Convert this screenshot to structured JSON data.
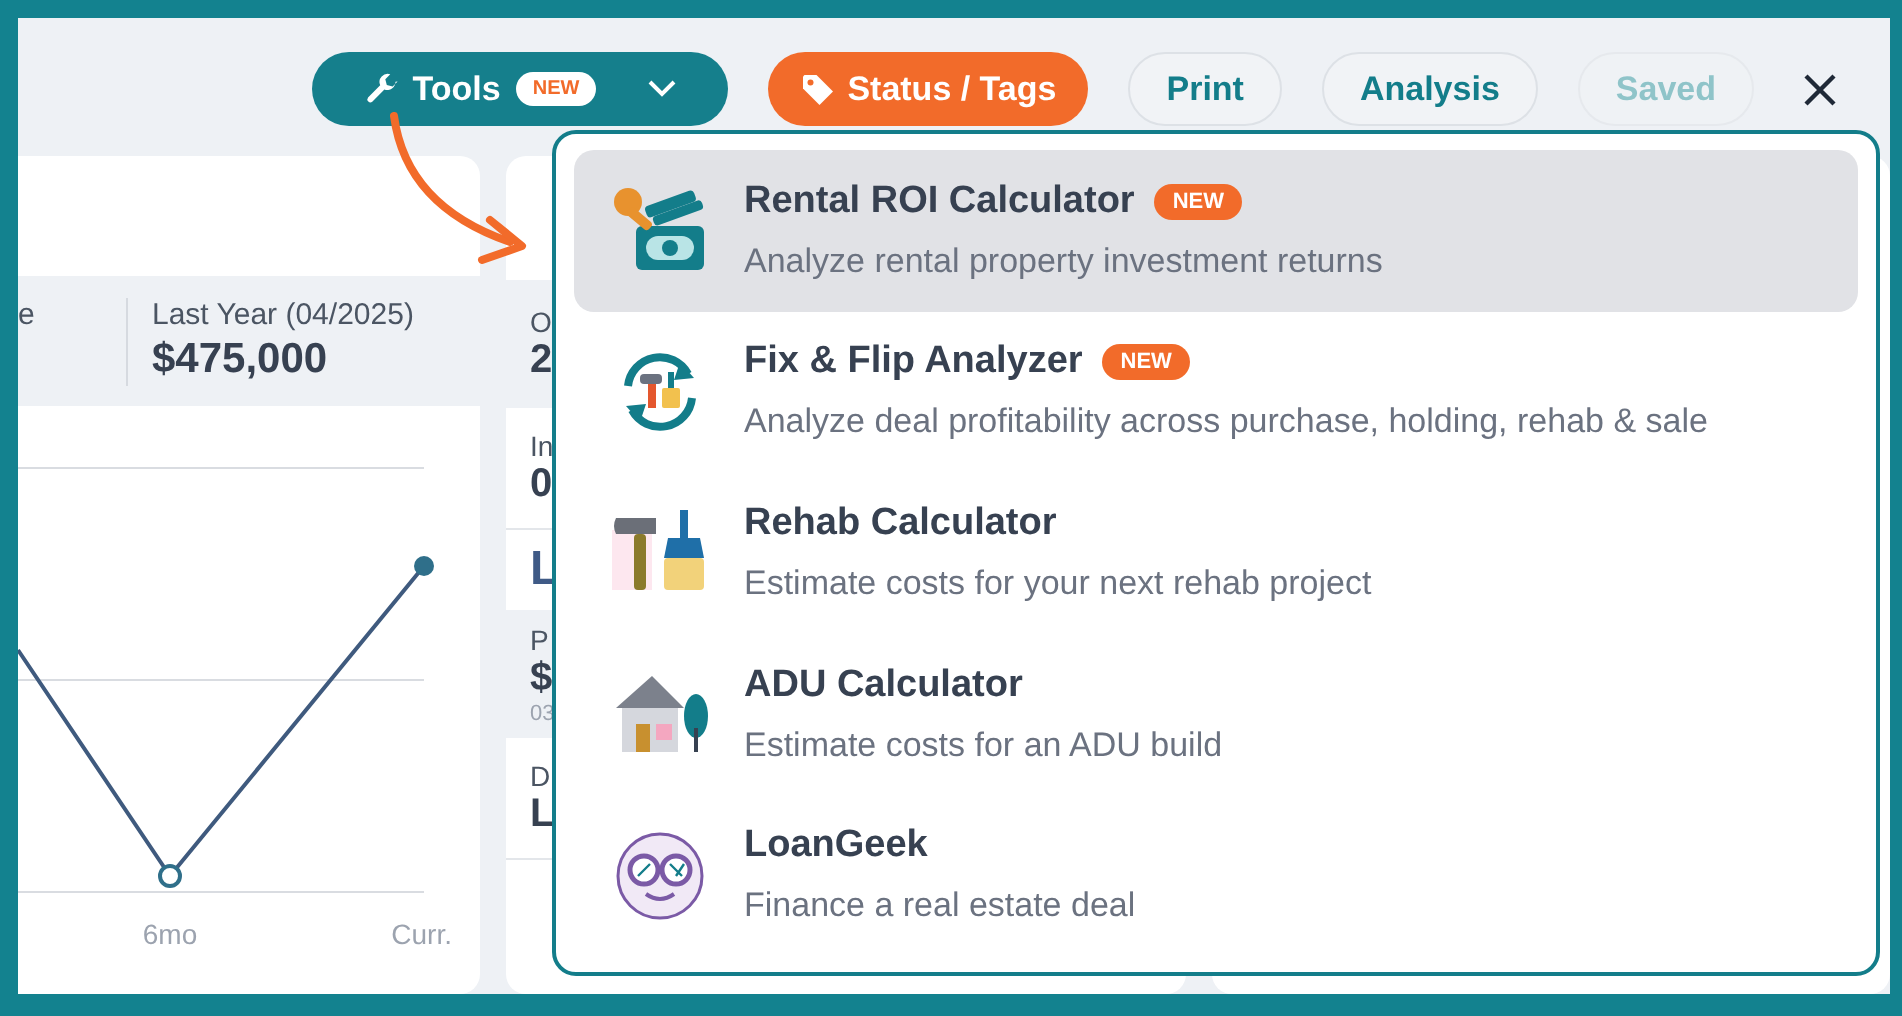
{
  "toolbar": {
    "tools_button": {
      "label": "Tools",
      "badge": "NEW",
      "expanded": true
    },
    "buttons": [
      {
        "label": "Status / Tags",
        "kind": "tag"
      },
      {
        "label": "Print",
        "kind": "plain",
        "disabled": false
      },
      {
        "label": "Analysis",
        "kind": "plain",
        "disabled": false
      },
      {
        "label": "Saved",
        "kind": "plain",
        "disabled": true
      }
    ]
  },
  "left_card": {
    "stats": [
      {
        "label": "e"
      },
      {
        "label": "Last Year (04/2025)",
        "value": "$475,000"
      }
    ],
    "chart": {
      "x_labels": [
        "6mo",
        "Curr."
      ]
    }
  },
  "middle_card": {
    "rows": [
      {
        "label": "O",
        "value": "2",
        "shaded": true
      },
      {
        "label": "In",
        "value": "0",
        "shaded": false
      }
    ],
    "section_title": "L",
    "section_rows": [
      {
        "label": "P",
        "value": "$",
        "note": "03",
        "shaded": true
      },
      {
        "label": "D",
        "value": "L",
        "shaded": false
      }
    ]
  },
  "tools_menu": [
    {
      "kind": "rental",
      "title": "Rental ROI Calculator",
      "badge": "NEW",
      "description": "Analyze rental property investment returns",
      "selected": true
    },
    {
      "kind": "flip",
      "title": "Fix & Flip Analyzer",
      "badge": "NEW",
      "description": "Analyze deal profitability across purchase, holding, rehab & sale",
      "selected": false
    },
    {
      "kind": "rehab",
      "title": "Rehab Calculator",
      "description": "Estimate costs for your next rehab project",
      "selected": false
    },
    {
      "kind": "adu",
      "title": "ADU Calculator",
      "description": "Estimate costs for an ADU build",
      "selected": false
    },
    {
      "kind": "loan",
      "title": "LoanGeek",
      "description": "Finance a real estate deal",
      "selected": false
    }
  ]
}
